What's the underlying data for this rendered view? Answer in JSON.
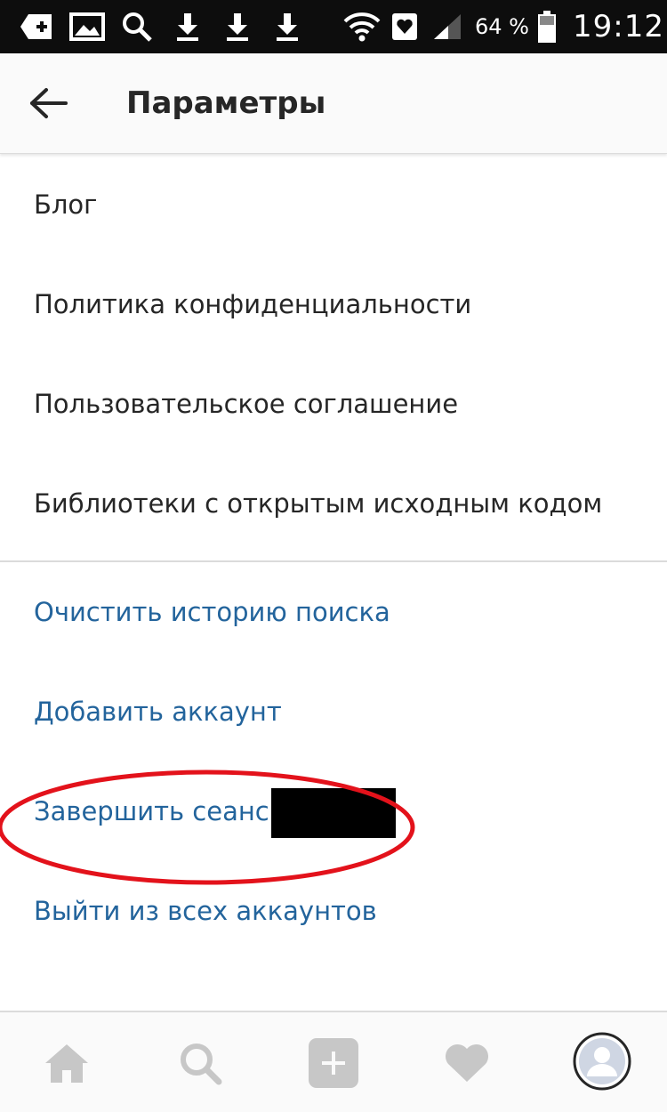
{
  "status_bar": {
    "battery_percent": "64 %",
    "time": "19:12",
    "icons": [
      "add-box-icon",
      "gallery-icon",
      "search-icon",
      "download-icon",
      "download-icon",
      "download-icon",
      "wifi-icon",
      "heart-square-icon",
      "signal-icon",
      "battery-icon"
    ]
  },
  "header": {
    "title": "Параметры",
    "back_icon": "arrow-left-icon"
  },
  "menu": {
    "info_items": [
      {
        "label": "Блог"
      },
      {
        "label": "Политика конфиденциальности"
      },
      {
        "label": "Пользовательское соглашение"
      },
      {
        "label": "Библиотеки с открытым исходным кодом"
      }
    ],
    "account_items": [
      {
        "label": "Очистить историю поиска"
      },
      {
        "label": "Добавить аккаунт"
      },
      {
        "label": "Завершить сеанс"
      },
      {
        "label": "Выйти из всех аккаунтов"
      }
    ]
  },
  "bottom_nav": {
    "items": [
      "home-icon",
      "search-icon",
      "add-post-icon",
      "heart-icon",
      "profile-avatar-icon"
    ]
  },
  "colors": {
    "status_bar": "#0d0d0d",
    "text": "#262626",
    "link": "#23649c",
    "nav_icon": "#c7c7c7",
    "highlight": "#e3121b"
  }
}
